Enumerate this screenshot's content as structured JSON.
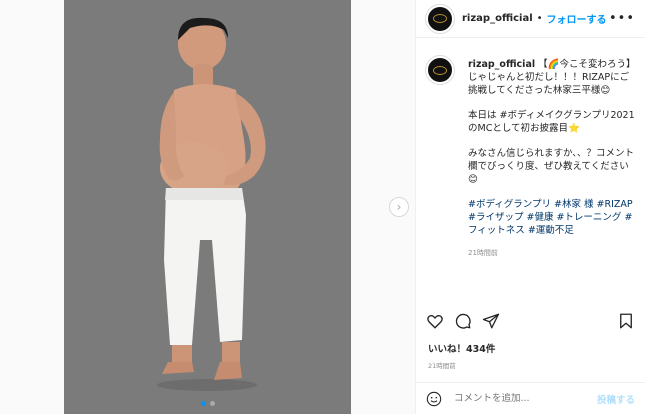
{
  "post": {
    "username": "rizap_official",
    "follow_separator": "•",
    "follow_label": "フォローする",
    "more_label": "•••",
    "caption_p1": "【🌈今こそ変わろう】じゃじゃんと初だし！！！RIZAPにご挑戦してくださった林家三平様😊",
    "caption_p2": "本日は #ボディメイクグランプリ2021 のMCとして初お披露目⭐",
    "caption_p3": "みなさん信じられますか、、？コメント欄でびっくり度、ぜひ教えてください😊",
    "caption_tags": "#ボディグランプリ #林家 様 #RIZAP #ライザップ #健康 #トレーニング #フィットネス #運動不足",
    "caption_time": "21時間前",
    "likes_label": "いいね！434件",
    "date_label": "21時間前",
    "comment_placeholder": "コメントを追加...",
    "post_label": "投稿する",
    "next_label": "›"
  },
  "icons": {
    "avatar": "rizap-logo-icon",
    "like": "heart-icon",
    "comment": "comment-bubble-icon",
    "share": "paper-plane-icon",
    "save": "bookmark-icon",
    "emoji": "smiley-icon",
    "next": "chevron-right-icon"
  },
  "colors": {
    "accent": "#0095f6",
    "post_disabled": "#b2dffc",
    "media_bg": "#7b7b7b"
  },
  "carousel": {
    "total": 2,
    "active": 1
  }
}
